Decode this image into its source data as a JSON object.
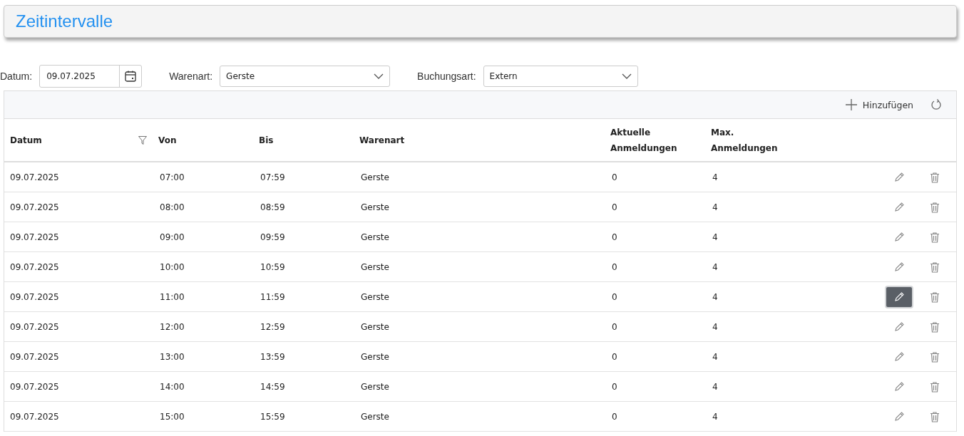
{
  "page_title": "Zeitintervalle",
  "filters": [
    {
      "label": "Datum:",
      "value": "09.07.2025",
      "kind": "date"
    },
    {
      "label": "Warenart:",
      "value": "Gerste",
      "kind": "select"
    },
    {
      "label": "Buchungsart:",
      "value": "Extern",
      "kind": "select"
    }
  ],
  "toolbar": {
    "add_label": "Hinzufügen"
  },
  "table": {
    "columns": [
      {
        "label": "Datum"
      },
      {
        "label": "Von"
      },
      {
        "label": "Bis"
      },
      {
        "label": "Warenart"
      },
      {
        "label": "Aktuelle Anmeldungen"
      },
      {
        "label": "Max. Anmeldungen"
      }
    ],
    "rows": [
      {
        "cells": [
          "09.07.2025",
          "07:00",
          "07:59",
          "Gerste",
          "0",
          "4"
        ],
        "edit_hovered": false
      },
      {
        "cells": [
          "09.07.2025",
          "08:00",
          "08:59",
          "Gerste",
          "0",
          "4"
        ],
        "edit_hovered": false
      },
      {
        "cells": [
          "09.07.2025",
          "09:00",
          "09:59",
          "Gerste",
          "0",
          "4"
        ],
        "edit_hovered": false
      },
      {
        "cells": [
          "09.07.2025",
          "10:00",
          "10:59",
          "Gerste",
          "0",
          "4"
        ],
        "edit_hovered": false
      },
      {
        "cells": [
          "09.07.2025",
          "11:00",
          "11:59",
          "Gerste",
          "0",
          "4"
        ],
        "edit_hovered": true
      },
      {
        "cells": [
          "09.07.2025",
          "12:00",
          "12:59",
          "Gerste",
          "0",
          "4"
        ],
        "edit_hovered": false
      },
      {
        "cells": [
          "09.07.2025",
          "13:00",
          "13:59",
          "Gerste",
          "0",
          "4"
        ],
        "edit_hovered": false
      },
      {
        "cells": [
          "09.07.2025",
          "14:00",
          "14:59",
          "Gerste",
          "0",
          "4"
        ],
        "edit_hovered": false
      },
      {
        "cells": [
          "09.07.2025",
          "15:00",
          "15:59",
          "Gerste",
          "0",
          "4"
        ],
        "edit_hovered": false
      }
    ]
  }
}
